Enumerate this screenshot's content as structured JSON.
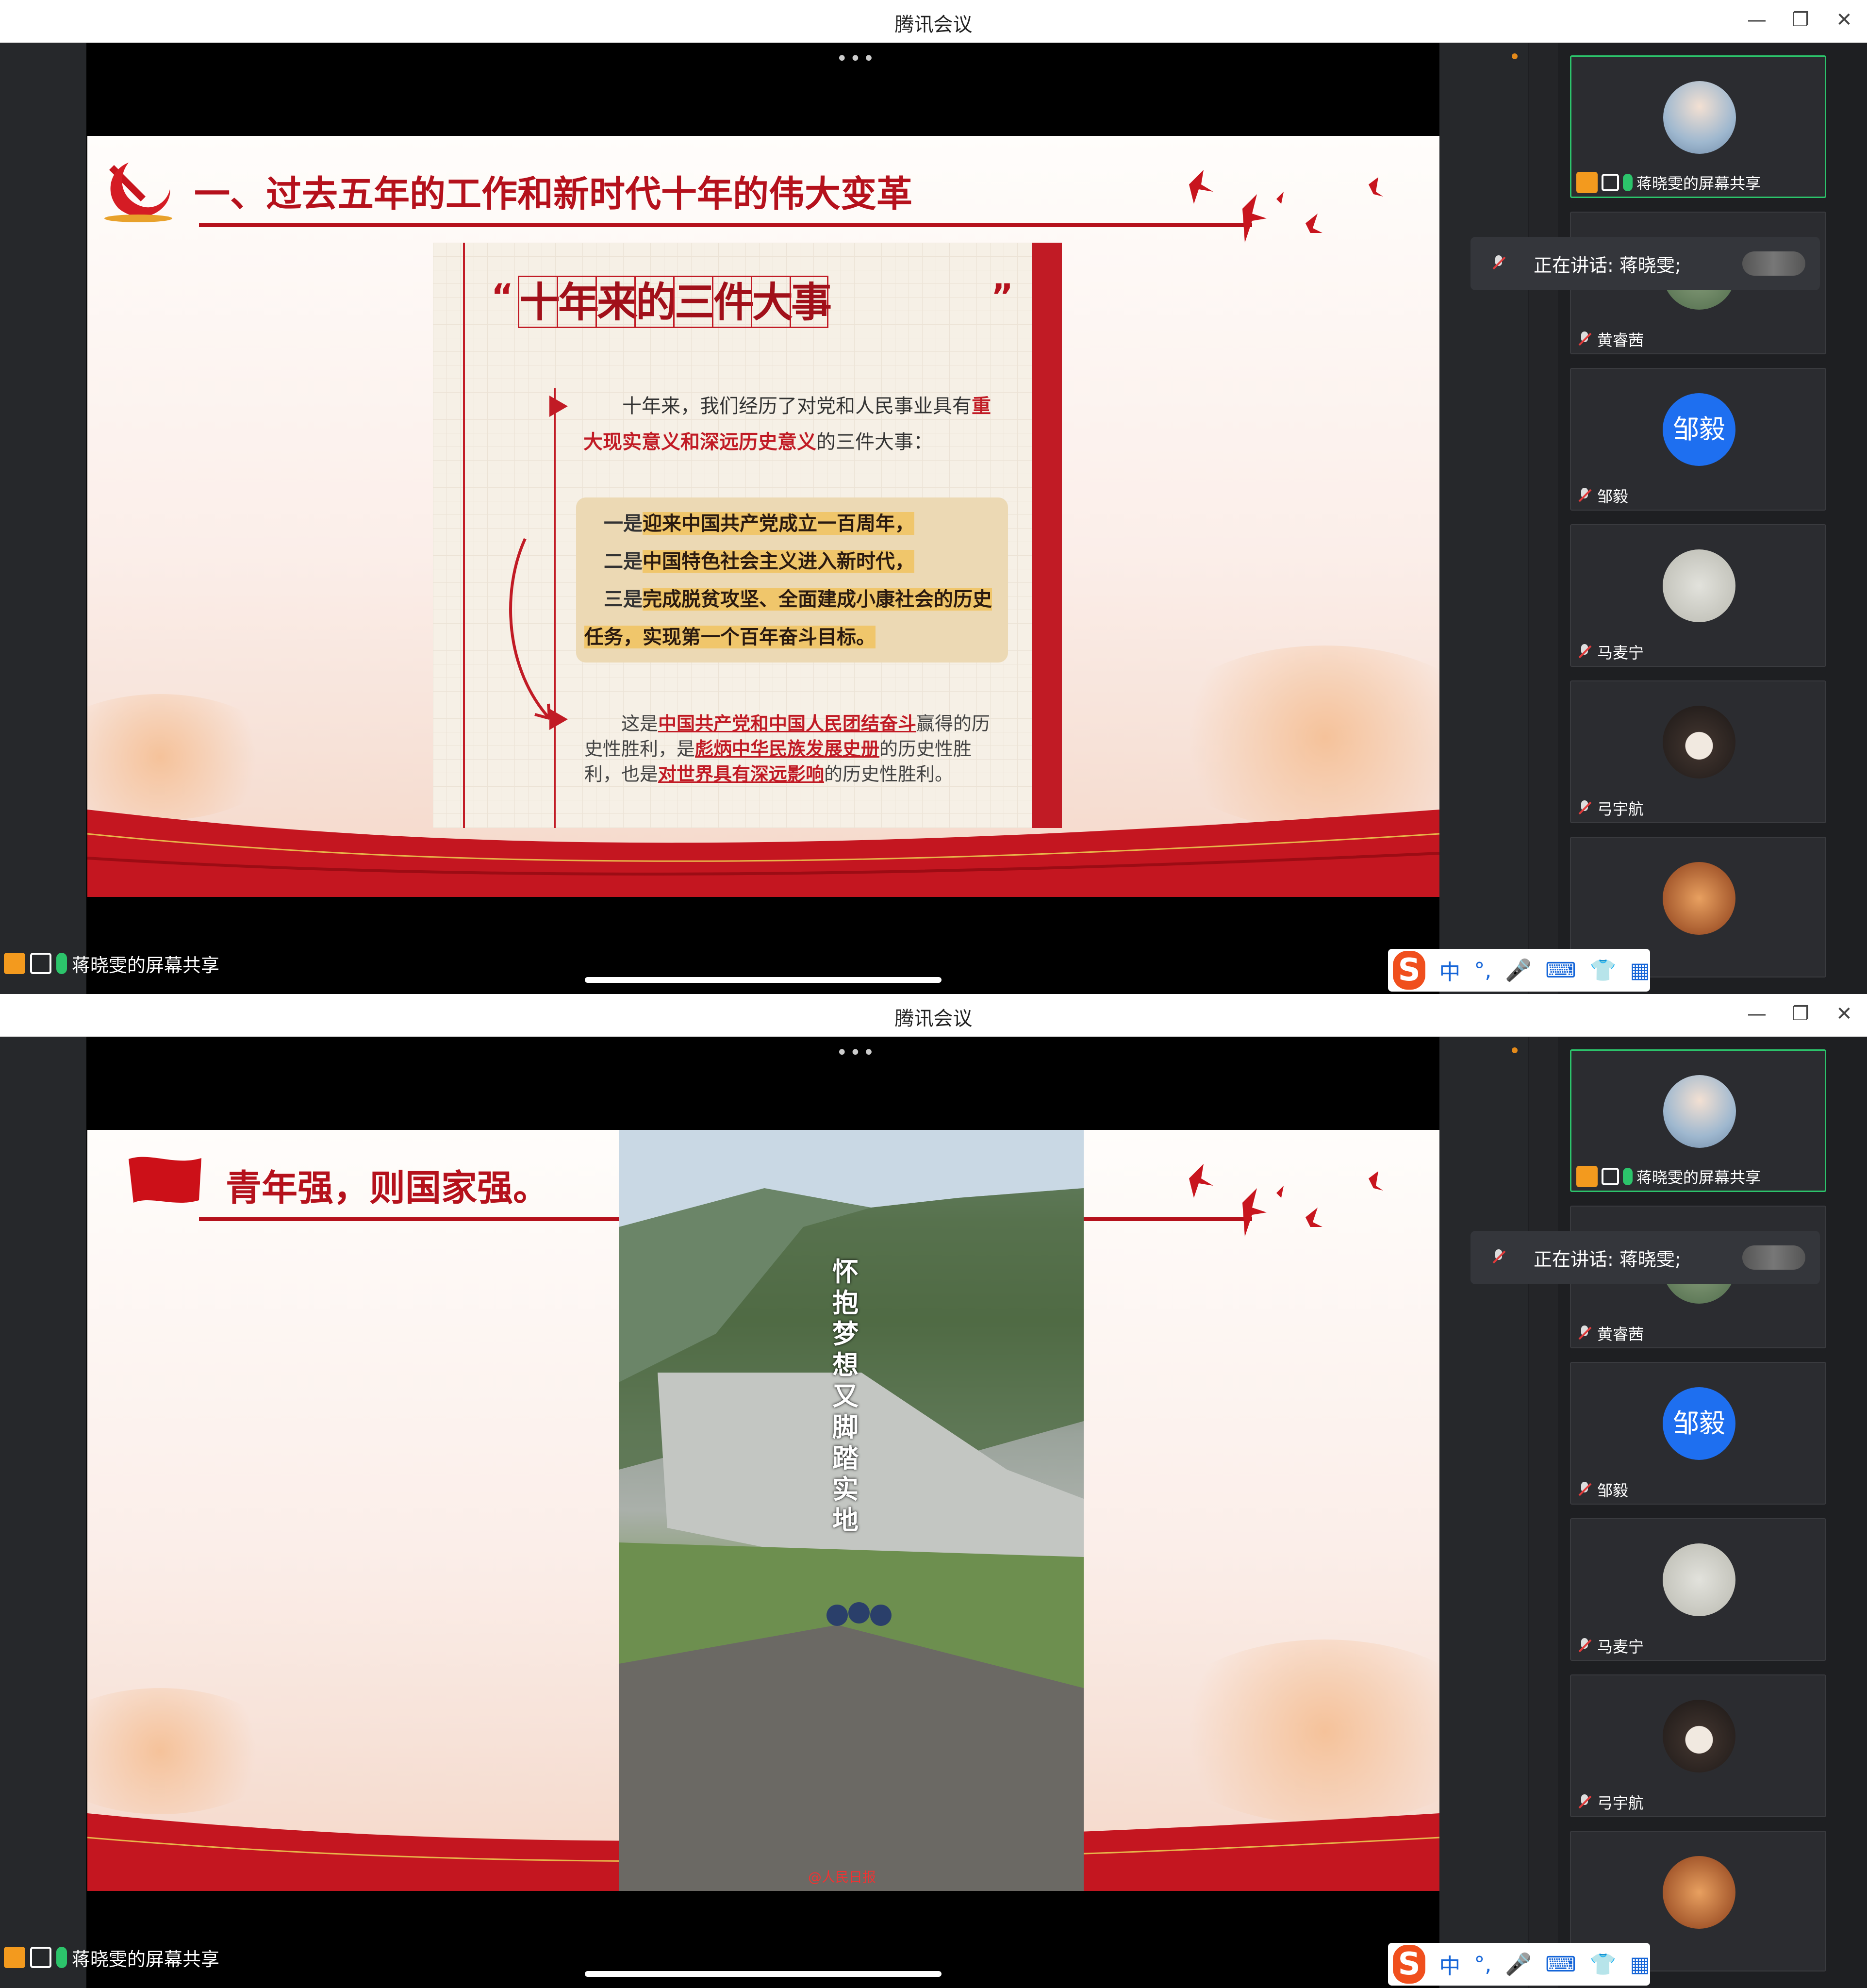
{
  "window": {
    "title": "腾讯会议",
    "min": "—",
    "max": "❐",
    "close": "✕"
  },
  "top_slide": {
    "title": "一、过去五年的工作和新时代十年的伟大变革",
    "big_title_chars": [
      "十",
      "年",
      "来",
      "的",
      "三",
      "件",
      "大",
      "事"
    ],
    "quote_open": "“",
    "quote_close": "”",
    "para1": "十年来，我们经历了对党和人民事业具有",
    "para1_bold": "重大现实意义和深远历史意义",
    "para1_tail": "的三件大事：",
    "item1_prefix": "一是",
    "item1": "迎来中国共产党成立一百周年，",
    "item2_prefix": "二是",
    "item2": "中国特色社会主义进入新时代，",
    "item3_prefix": "三是",
    "item3": "完成脱贫攻坚、全面建成小康社会的历史任务，实现第一个百年奋斗目标。",
    "conc_a": "这是",
    "conc_b": "中国共产党和中国人民团结奋斗",
    "conc_c": "赢得的历史性胜利，是",
    "conc_d": "彪炳中华民族发展史册",
    "conc_e": "的历史性胜利，也是",
    "conc_f": "对世界具有深远影响",
    "conc_g": "的历史性胜利。"
  },
  "bottom_slide": {
    "title": "青年强，则国家强。",
    "video_caption": "怀抱梦想 又脚踏实地",
    "watermark": "@人民日报"
  },
  "share_label": "蒋晓雯的屏幕共享",
  "speaking": "正在讲话: 蒋晓雯;",
  "participants": [
    {
      "name": "蒋晓雯的屏幕共享",
      "avatar_color": "#9fb8cf",
      "initial": ""
    },
    {
      "name": "黄睿茜",
      "avatar_color": "#6a8a6a",
      "initial": ""
    },
    {
      "name": "邹毅",
      "avatar_color": "#1e6ff0",
      "initial": "邹毅"
    },
    {
      "name": "马麦宁",
      "avatar_color": "#cfcfc8",
      "initial": ""
    },
    {
      "name": "弓宇航",
      "avatar_color": "#3a2f2a",
      "initial": ""
    },
    {
      "name": "",
      "avatar_color": "#b5652a",
      "initial": ""
    }
  ],
  "ime": {
    "logo": "S",
    "lang": "中",
    "punct": "°,",
    "mic": "🎤",
    "kbd": "⌨",
    "skin": "👕",
    "apps": "▦"
  },
  "colors": {
    "accent_red": "#b5111c",
    "active_green": "#2cc46b"
  }
}
